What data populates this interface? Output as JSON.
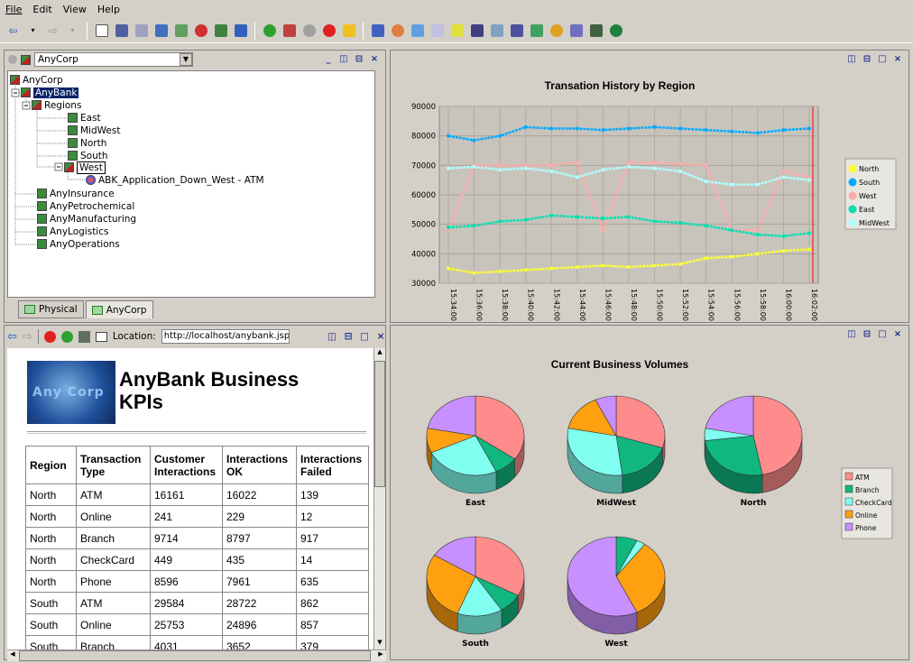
{
  "menu": [
    "File",
    "Edit",
    "View",
    "Help"
  ],
  "tree_panel": {
    "selector_value": "AnyCorp",
    "tabs": [
      "Physical",
      "AnyCorp"
    ]
  },
  "tree": [
    "AnyCorp",
    "AnyBank",
    "Regions",
    "East",
    "MidWest",
    "North",
    "South",
    "West",
    "ABK_Application_Down_West - ATM",
    "AnyInsurance",
    "AnyPetrochemical",
    "AnyManufacturing",
    "AnyLogistics",
    "AnyOperations"
  ],
  "browser": {
    "location_label": "Location:",
    "url": "http://localhost/anybank.jsp",
    "title": "AnyBank Business KPIs",
    "logo_text": "Any Corp"
  },
  "kpi_table": {
    "headers": [
      "Region",
      "Transaction Type",
      "Customer Interactions",
      "Interactions OK",
      "Interactions Failed"
    ],
    "rows": [
      [
        "North",
        "ATM",
        "16161",
        "16022",
        "139"
      ],
      [
        "North",
        "Online",
        "241",
        "229",
        "12"
      ],
      [
        "North",
        "Branch",
        "9714",
        "8797",
        "917"
      ],
      [
        "North",
        "CheckCard",
        "449",
        "435",
        "14"
      ],
      [
        "North",
        "Phone",
        "8596",
        "7961",
        "635"
      ],
      [
        "South",
        "ATM",
        "29584",
        "28722",
        "862"
      ],
      [
        "South",
        "Online",
        "25753",
        "24896",
        "857"
      ],
      [
        "South",
        "Branch",
        "4031",
        "3652",
        "379"
      ]
    ]
  },
  "chart_data": [
    {
      "type": "line",
      "title": "Transation History by Region",
      "x": [
        "15:34:00",
        "15:36:00",
        "15:38:00",
        "15:40:00",
        "15:42:00",
        "15:44:00",
        "15:46:00",
        "15:48:00",
        "15:50:00",
        "15:52:00",
        "15:54:00",
        "15:56:00",
        "15:58:00",
        "16:00:00",
        "16:02:00"
      ],
      "ylim": [
        30000,
        90000
      ],
      "yticks": [
        "90000",
        "80000",
        "70000",
        "60000",
        "50000",
        "40000",
        "30000"
      ],
      "legend": "right",
      "series": [
        {
          "name": "North",
          "color": "#ffff33",
          "values": [
            35000,
            33500,
            34000,
            34500,
            35000,
            35500,
            36000,
            35500,
            36000,
            36500,
            38500,
            39000,
            40000,
            41000,
            41500
          ]
        },
        {
          "name": "South",
          "color": "#00aaff",
          "values": [
            80000,
            78500,
            80000,
            83000,
            82500,
            82500,
            82000,
            82500,
            83000,
            82500,
            82000,
            81500,
            81000,
            82000,
            82500
          ]
        },
        {
          "name": "West",
          "color": "#ffaaaa",
          "values": [
            48000,
            70000,
            70000,
            70000,
            70000,
            71000,
            48000,
            71000,
            71000,
            70500,
            70000,
            48000,
            48000,
            68000,
            66000
          ]
        },
        {
          "name": "East",
          "color": "#00e0b0",
          "values": [
            49000,
            49500,
            51000,
            51500,
            53000,
            52500,
            52000,
            52500,
            51000,
            50500,
            49500,
            48000,
            46500,
            46000,
            47000
          ]
        },
        {
          "name": "MidWest",
          "color": "#b0ffff",
          "values": [
            69000,
            69500,
            68500,
            69000,
            68000,
            66000,
            68500,
            69500,
            69000,
            68000,
            64500,
            63500,
            63500,
            66000,
            65000
          ]
        }
      ]
    },
    {
      "type": "pie",
      "title": "Current Business Volumes",
      "categories": [
        "ATM",
        "Branch",
        "CheckCard",
        "Online",
        "Phone"
      ],
      "colors": [
        "#ff8c8c",
        "#10b880",
        "#80fff0",
        "#ffa010",
        "#c890ff"
      ],
      "pies": [
        {
          "name": "East",
          "values": [
            35,
            8,
            25,
            10,
            22
          ]
        },
        {
          "name": "MidWest",
          "values": [
            30,
            18,
            30,
            15,
            7
          ]
        },
        {
          "name": "North",
          "values": [
            47,
            26,
            5,
            0,
            22
          ]
        },
        {
          "name": "South",
          "values": [
            33,
            8,
            15,
            28,
            16
          ]
        },
        {
          "name": "West",
          "values": [
            0,
            7,
            3,
            33,
            57
          ]
        }
      ]
    }
  ]
}
